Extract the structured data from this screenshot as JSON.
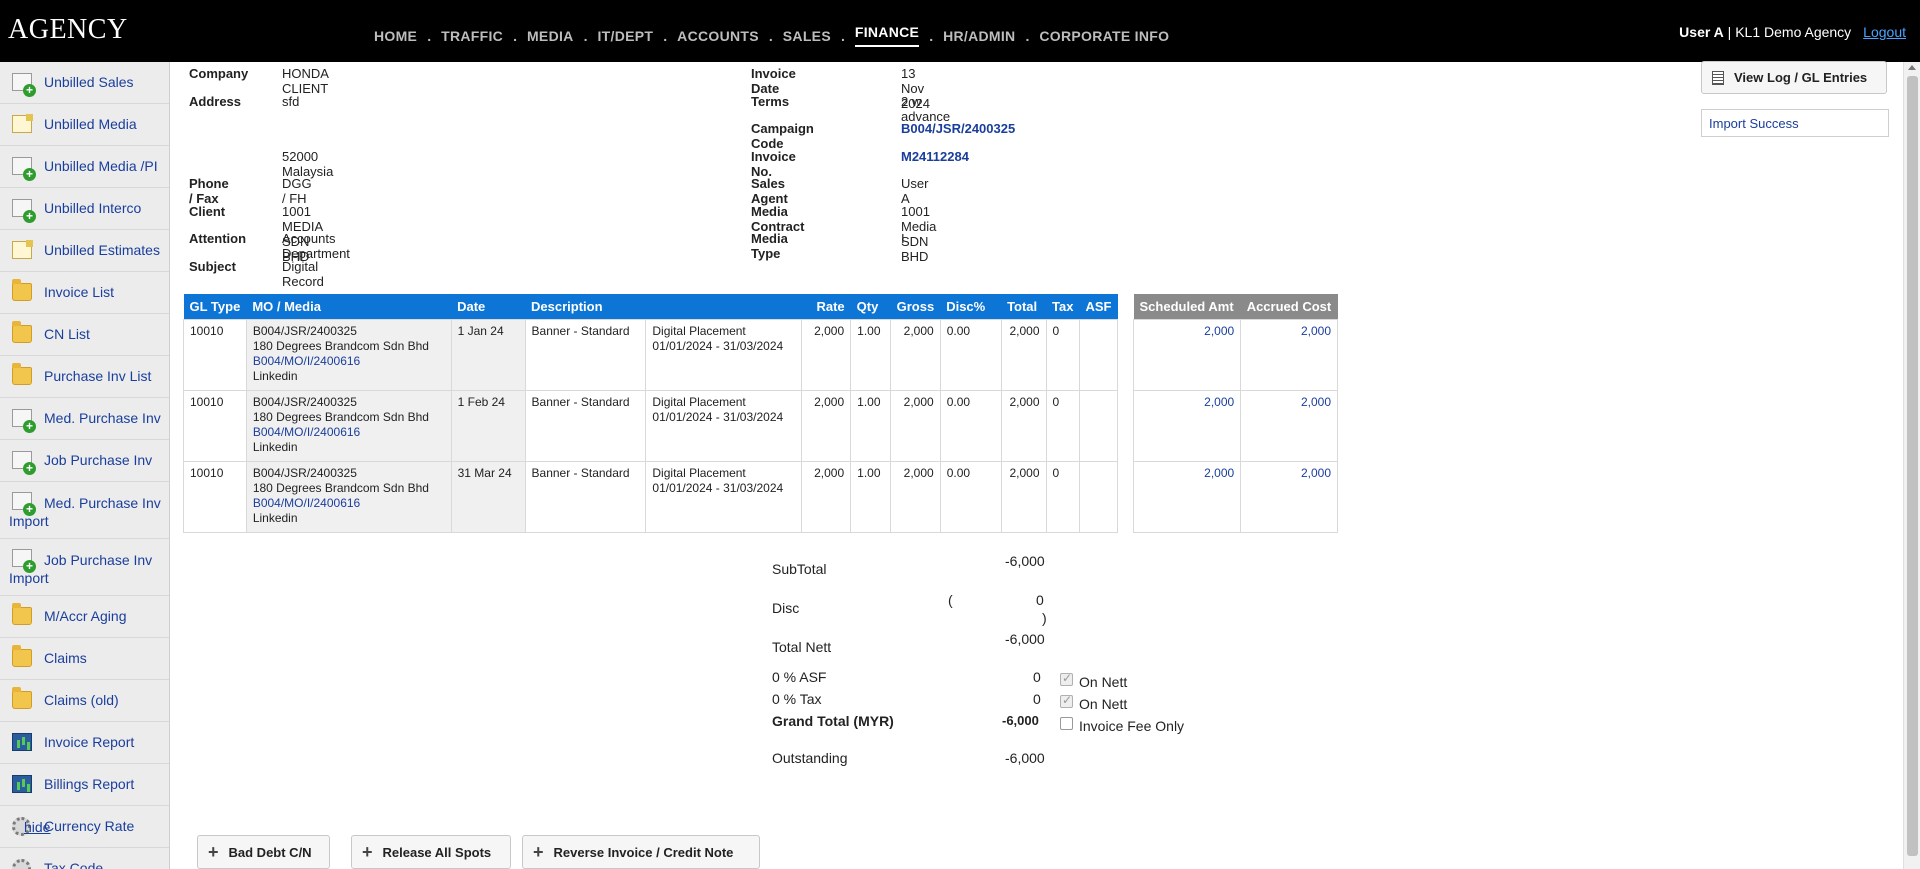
{
  "app": {
    "brand": "AGENCY"
  },
  "nav": {
    "items": [
      "HOME",
      "TRAFFIC",
      "MEDIA",
      "IT/DEPT",
      "ACCOUNTS",
      "SALES",
      "FINANCE",
      "HR/ADMIN",
      "CORPORATE INFO"
    ],
    "active": "FINANCE",
    "separator": "."
  },
  "user": {
    "name": "User A",
    "org": " | KL1 Demo Agency",
    "logout": "Logout"
  },
  "sidebar": {
    "items": [
      {
        "label": "Unbilled Sales",
        "icon": "add-document-icon"
      },
      {
        "label": "Unbilled Media",
        "icon": "document-icon"
      },
      {
        "label": "Unbilled Media /PI",
        "icon": "add-document-icon"
      },
      {
        "label": "Unbilled Interco",
        "icon": "add-document-icon"
      },
      {
        "label": "Unbilled Estimates",
        "icon": "document-icon"
      },
      {
        "label": "Invoice List",
        "icon": "folder-icon"
      },
      {
        "label": "CN List",
        "icon": "folder-icon"
      },
      {
        "label": "Purchase Inv List",
        "icon": "folder-icon"
      },
      {
        "label": "Med. Purchase Inv",
        "icon": "add-document-icon"
      },
      {
        "label": "Job Purchase Inv",
        "icon": "add-document-icon"
      },
      {
        "label": "Med. Purchase Inv Import",
        "icon": "add-document-icon"
      },
      {
        "label": "Job Purchase Inv Import",
        "icon": "add-document-icon"
      },
      {
        "label": "M/Accr Aging",
        "icon": "folder-icon"
      },
      {
        "label": "Claims",
        "icon": "folder-icon"
      },
      {
        "label": "Claims (old)",
        "icon": "folder-icon"
      },
      {
        "label": "Invoice Report",
        "icon": "chart-icon"
      },
      {
        "label": "Billings Report",
        "icon": "chart-icon"
      },
      {
        "label": "Currency Rate",
        "icon": "gear-icon"
      },
      {
        "label": "Tax Code",
        "icon": "gear-icon"
      }
    ],
    "hide_label": "hide"
  },
  "invoice": {
    "left": {
      "company_label": "Company",
      "company": "HONDA CLIENT",
      "address_label": "Address",
      "address_line1": "sfd",
      "address_line3": "52000 Malaysia",
      "phone_label": "Phone / Fax",
      "phone": "DGG / FH",
      "client_label": "Client",
      "client": "1001 MEDIA SDN BHD",
      "attention_label": "Attention",
      "attention": "Accounts Department",
      "subject_label": "Subject",
      "subject": "Digital Record"
    },
    "right": {
      "date_label": "Invoice Date",
      "date": "13 Nov 2024",
      "terms_label": "Terms",
      "terms": "2 w advance",
      "campaign_label": "Campaign Code",
      "campaign": "B004/JSR/2400325",
      "invoice_no_label": "Invoice No.",
      "invoice_no": "M24112284",
      "agent_label": "Sales Agent",
      "agent": "User A",
      "contract_label": "Media Contract",
      "contract": "1001 Media SDN BHD",
      "media_type_label": "Media Type",
      "media_type": "I"
    }
  },
  "actions": {
    "view_log": "View Log / GL Entries",
    "import_status": "Import Success"
  },
  "table": {
    "headers": [
      "GL Type",
      "MO / Media",
      "Date",
      "Description",
      "",
      "Rate",
      "Qty",
      "Gross",
      "Disc%",
      "Total",
      "Tax",
      "ASF"
    ],
    "rows": [
      {
        "gl": "10010",
        "mo1": "B004/JSR/2400325",
        "mo2": "180 Degrees Brandcom Sdn Bhd",
        "mo_link": "B004/MO/I/2400616",
        "mo4": "Linkedin",
        "date": "1 Jan 24",
        "desc": "Banner - Standard",
        "desc2a": "Digital Placement",
        "desc2b": "01/01/2024 - 31/03/2024",
        "rate": "2,000",
        "qty": "1.00",
        "gross": "2,000",
        "disc": "0.00",
        "total": "2,000",
        "tax": "0",
        "asf": ""
      },
      {
        "gl": "10010",
        "mo1": "B004/JSR/2400325",
        "mo2": "180 Degrees Brandcom Sdn Bhd",
        "mo_link": "B004/MO/I/2400616",
        "mo4": "Linkedin",
        "date": "1 Feb 24",
        "desc": "Banner - Standard",
        "desc2a": "Digital Placement",
        "desc2b": "01/01/2024 - 31/03/2024",
        "rate": "2,000",
        "qty": "1.00",
        "gross": "2,000",
        "disc": "0.00",
        "total": "2,000",
        "tax": "0",
        "asf": ""
      },
      {
        "gl": "10010",
        "mo1": "B004/JSR/2400325",
        "mo2": "180 Degrees Brandcom Sdn Bhd",
        "mo_link": "B004/MO/I/2400616",
        "mo4": "Linkedin",
        "date": "31 Mar 24",
        "desc": "Banner - Standard",
        "desc2a": "Digital Placement",
        "desc2b": "01/01/2024 - 31/03/2024",
        "rate": "2,000",
        "qty": "1.00",
        "gross": "2,000",
        "disc": "0.00",
        "total": "2,000",
        "tax": "0",
        "asf": ""
      }
    ]
  },
  "schedule": {
    "headers": [
      "Scheduled Amt",
      "Accrued Cost"
    ],
    "rows": [
      [
        "2,000",
        "2,000"
      ],
      [
        "2,000",
        "2,000"
      ],
      [
        "2,000",
        "2,000"
      ]
    ]
  },
  "totals": {
    "subtotal_label": "SubTotal",
    "subtotal": "-6,000",
    "disc_label": "Disc",
    "disc_open": "(",
    "disc": "0",
    "disc_close": ")",
    "nett_label": "Total Nett",
    "nett": "-6,000",
    "asf_label": "0 % ASF",
    "asf": "0",
    "asf_check": "On Nett",
    "tax_label": "0 % Tax",
    "tax": "0",
    "tax_check": "On Nett",
    "grand_label": "Grand Total (MYR)",
    "grand": "-6,000",
    "fee_check": "Invoice Fee Only",
    "outstanding_label": "Outstanding",
    "outstanding": "-6,000"
  },
  "bottom_buttons": {
    "bad_debt": "Bad Debt C/N",
    "release": "Release All Spots",
    "reverse": "Reverse Invoice / Credit Note"
  }
}
